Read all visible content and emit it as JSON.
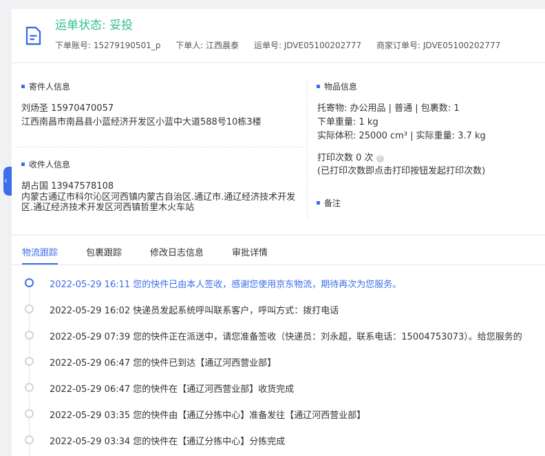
{
  "header": {
    "status_title": "运单状态: 妥投",
    "order_account": "下单账号: 15279190501_p",
    "orderer": "下单人: 江西晨泰",
    "waybill_no": "运单号: JDVE05100202777",
    "merchant_order_no": "商家订单号: JDVE05100202777"
  },
  "sender": {
    "section_title": "寄件人信息",
    "name_phone": "刘炀圣   15970470057",
    "address": "江西南昌市南昌县小蓝经济开发区小蓝中大道588号10栋3楼"
  },
  "receiver": {
    "section_title": "收件人信息",
    "name_phone": "胡占国   13947578108",
    "address": "内蒙古通辽市科尔沁区河西镇内蒙古自治区.通辽市.通辽经济技术开发区.通辽经济技术开发区河西镇哲里木火车站"
  },
  "goods": {
    "section_title": "物品信息",
    "line1": "托寄物:  办公用品 | 普通  |  包裹数:  1",
    "line2": "下单重量:  1 kg",
    "line3": "实际体积:   25000 cm³  |  实际重量:   3.7 kg",
    "print_count": "打印次数    0 次",
    "print_note": "(已打印次数即点击打印按钮发起打印次数)",
    "remark_title": "备注"
  },
  "tabs": [
    "物流跟踪",
    "包裹跟踪",
    "修改日志信息",
    "审批详情"
  ],
  "active_tab": 0,
  "timeline": [
    "2022-05-29 16:11  您的快件已由本人签收，感谢您使用京东物流，期待再次为您服务。",
    "2022-05-29 16:02  快递员发起系统呼叫联系客户，呼叫方式：拨打电话",
    "2022-05-29 07:39  您的快件正在派送中，请您准备签收（快递员：刘永超，联系电话：15004753073）。给您服务的",
    "2022-05-29 06:47  您的快件已到达【通辽河西营业部】",
    "2022-05-29 06:47  您的快件在【通辽河西营业部】收货完成",
    "2022-05-29 03:35  您的快件由【通辽分拣中心】准备发往【通辽河西营业部】",
    "2022-05-29 03:34  您的快件在【通辽分拣中心】分拣完成"
  ],
  "icons": {
    "document": "document-icon",
    "collapse": "chevron-left-icon",
    "help": "help-circle-icon"
  },
  "colors": {
    "status_green": "#2fbf8c",
    "accent_blue": "#3b6ee8"
  }
}
